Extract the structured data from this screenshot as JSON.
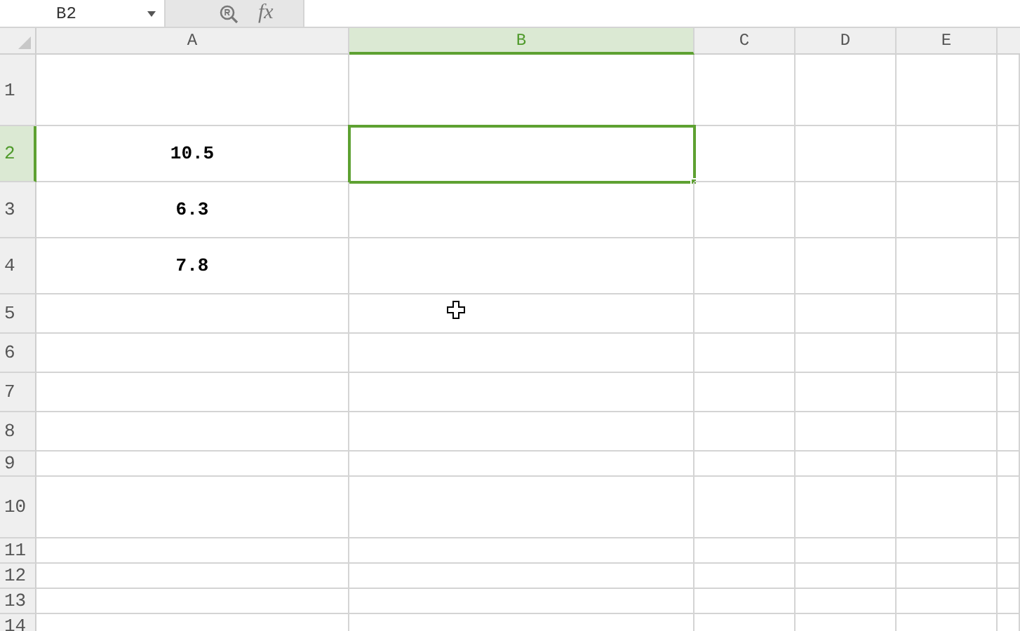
{
  "name_box": "B2",
  "formula_bar": {
    "function_label": "fx"
  },
  "columns": [
    {
      "label": "A",
      "selected": false
    },
    {
      "label": "B",
      "selected": true
    },
    {
      "label": "C",
      "selected": false
    },
    {
      "label": "D",
      "selected": false
    },
    {
      "label": "E",
      "selected": false
    }
  ],
  "rows": [
    {
      "label": "1",
      "selected": false
    },
    {
      "label": "2",
      "selected": true,
      "cells": [
        "10.5"
      ]
    },
    {
      "label": "3",
      "selected": false,
      "cells": [
        "6.3"
      ]
    },
    {
      "label": "4",
      "selected": false,
      "cells": [
        "7.8"
      ]
    },
    {
      "label": "5",
      "selected": false
    },
    {
      "label": "6",
      "selected": false
    },
    {
      "label": "7",
      "selected": false
    },
    {
      "label": "8",
      "selected": false
    },
    {
      "label": "9",
      "selected": false
    },
    {
      "label": "10",
      "selected": false
    },
    {
      "label": "11",
      "selected": false
    },
    {
      "label": "12",
      "selected": false
    },
    {
      "label": "13",
      "selected": false
    },
    {
      "label": "14",
      "selected": false
    }
  ]
}
